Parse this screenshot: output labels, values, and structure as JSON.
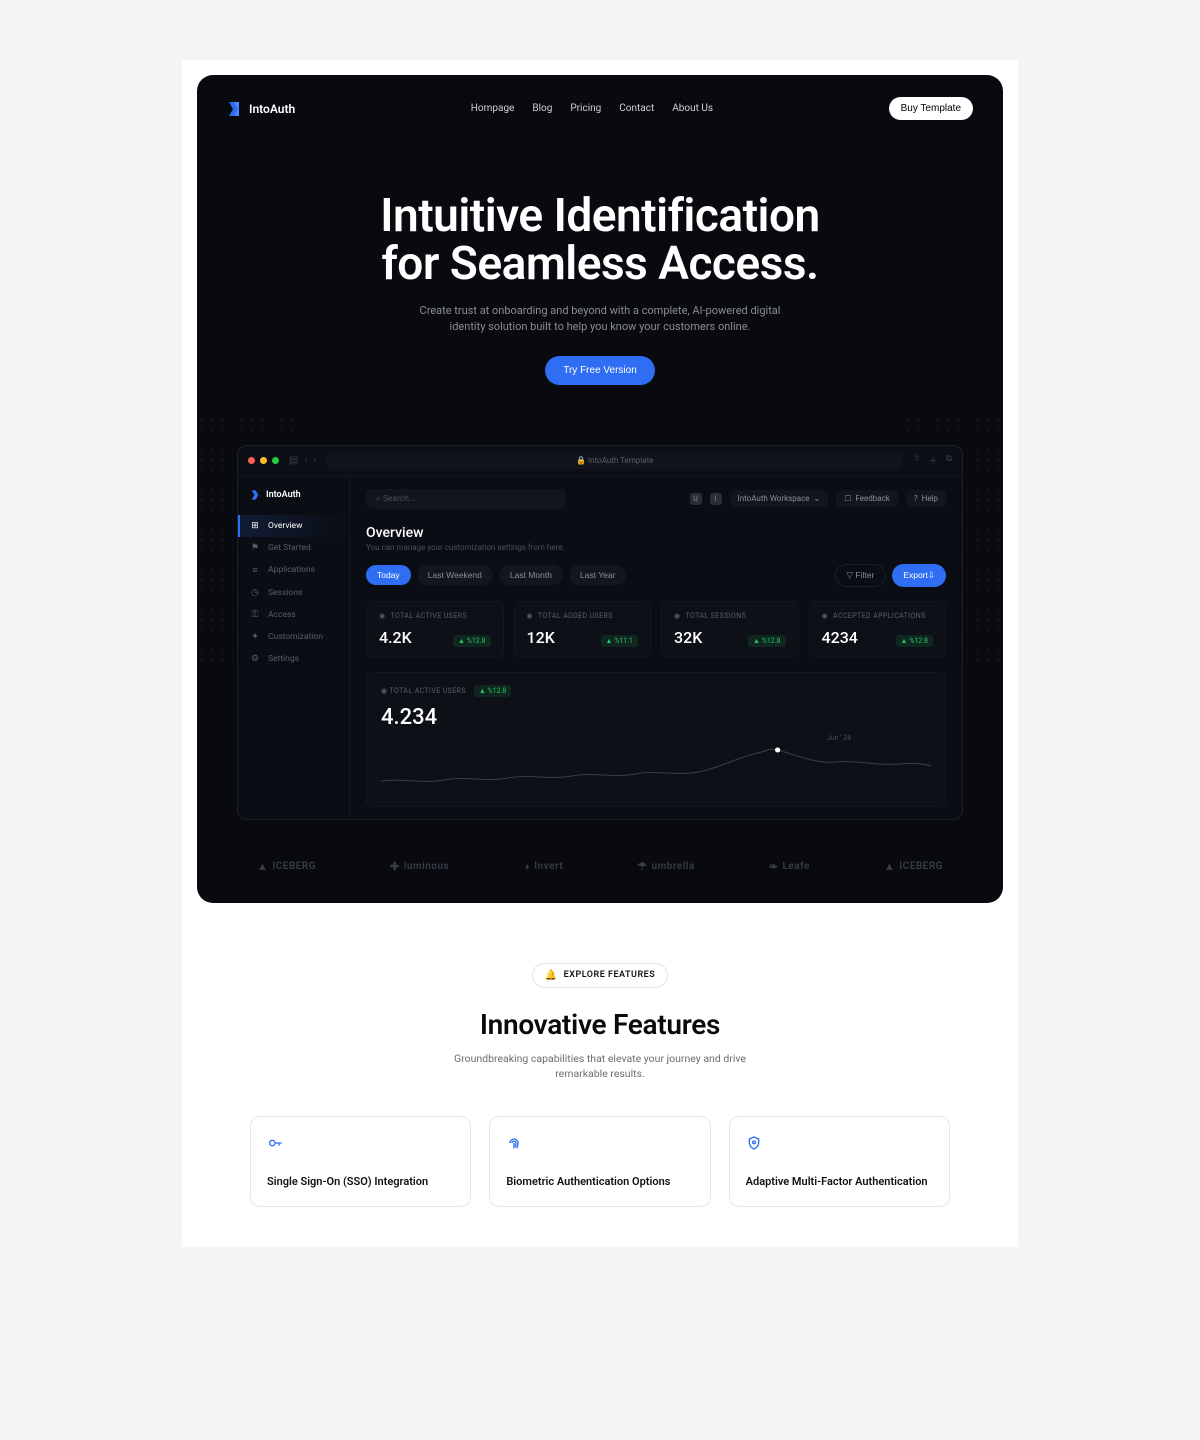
{
  "header": {
    "brand": "IntoAuth",
    "nav": [
      "Hompage",
      "Blog",
      "Pricing",
      "Contact",
      "About Us"
    ],
    "buy_label": "Buy Template"
  },
  "hero": {
    "title": "Intuitive Identification for Seamless Access.",
    "subtitle": "Create trust at onboarding and beyond with a complete, AI-powered digital identity solution built to help you know your customers online.",
    "cta": "Try Free Version"
  },
  "browser": {
    "url": "IntoAuth Template"
  },
  "dash": {
    "brand": "IntoAuth",
    "sidebar": [
      {
        "icon": "⊞",
        "label": "Overview",
        "active": true
      },
      {
        "icon": "⚑",
        "label": "Get Started"
      },
      {
        "icon": "≡",
        "label": "Applications"
      },
      {
        "icon": "◷",
        "label": "Sessions"
      },
      {
        "icon": "⚿",
        "label": "Access"
      },
      {
        "icon": "✦",
        "label": "Customization"
      },
      {
        "icon": "⚙",
        "label": "Settings"
      }
    ],
    "search_placeholder": "Search...",
    "workspace": "IntoAuth Workspace",
    "feedback": "Feedback",
    "help": "Help",
    "title": "Overview",
    "subtitle": "You can manage your customization settings from here.",
    "tabs": [
      "Today",
      "Last Weekend",
      "Last Month",
      "Last Year"
    ],
    "filter": "Filter",
    "export": "Export",
    "cards": [
      {
        "label": "TOTAL ACTIVE USERS",
        "value": "4.2K",
        "delta": "▲ %12.8"
      },
      {
        "label": "TOTAL ADDED USERS",
        "value": "12K",
        "delta": "▲ %11.1"
      },
      {
        "label": "TOTAL SESSIONS",
        "value": "32K",
        "delta": "▲ %12.8"
      },
      {
        "label": "ACCEPTED APPLICATIONS",
        "value": "4234",
        "delta": "▲ %12.8"
      }
    ],
    "chart": {
      "label": "TOTAL ACTIVE USERS",
      "delta": "▲ %12.8",
      "value": "4.234",
      "date": "Jun ' 24"
    }
  },
  "sponsors": [
    "ICEBERG",
    "luminous",
    "Invert",
    "umbrella",
    "Leafe",
    "ICEBERG"
  ],
  "features": {
    "pill": "EXPLORE FEATURES",
    "title": "Innovative Features",
    "subtitle": "Groundbreaking capabilities that elevate your journey and drive remarkable results.",
    "cards": [
      {
        "icon": "key",
        "title": "Single Sign-On (SSO) Integration"
      },
      {
        "icon": "fingerprint",
        "title": "Biometric Authentication Options"
      },
      {
        "icon": "shield",
        "title": "Adaptive Multi-Factor Authentication"
      }
    ]
  }
}
